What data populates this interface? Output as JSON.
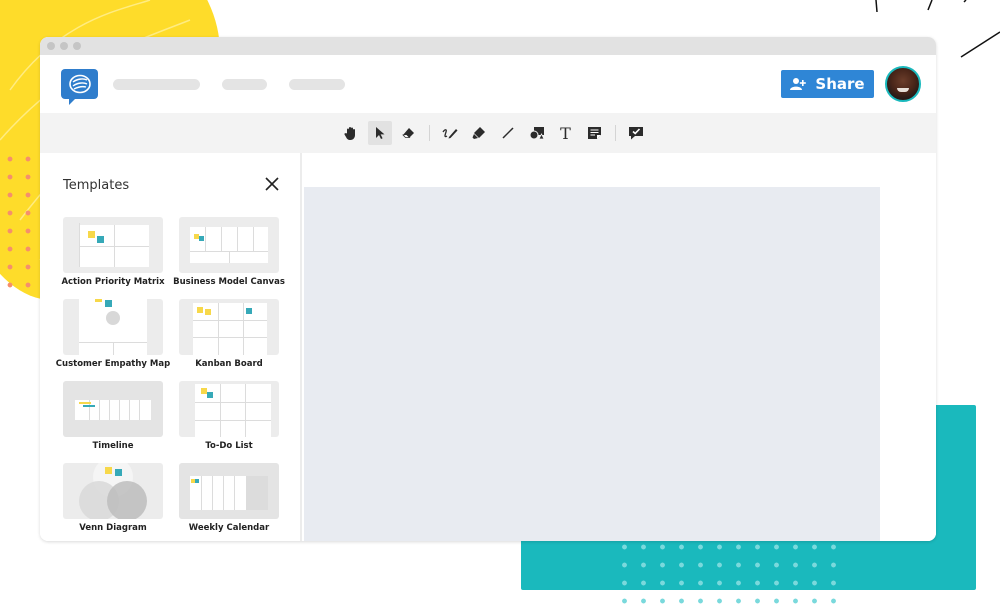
{
  "app": {
    "window_controls": [
      "close",
      "minimize",
      "maximize"
    ],
    "logo_icon": "chat-bubble-logo-icon",
    "nav_placeholders": 3
  },
  "header": {
    "share_label": "Share",
    "share_icon": "add-user-icon",
    "avatar": "user-avatar"
  },
  "toolbar": {
    "tools": [
      {
        "name": "pan",
        "icon": "hand-icon",
        "active": false
      },
      {
        "name": "select",
        "icon": "cursor-arrow-icon",
        "active": true
      },
      {
        "name": "eraser",
        "icon": "eraser-icon",
        "active": false
      },
      {
        "name": "pen",
        "icon": "pen-icon",
        "active": false
      },
      {
        "name": "highlighter",
        "icon": "highlighter-icon",
        "active": false
      },
      {
        "name": "line",
        "icon": "line-icon",
        "active": false
      },
      {
        "name": "shapes",
        "icon": "shapes-icon",
        "active": false
      },
      {
        "name": "text",
        "icon": "text-icon",
        "active": false
      },
      {
        "name": "sticky-note",
        "icon": "sticky-note-icon",
        "active": false
      },
      {
        "name": "comment",
        "icon": "comment-check-icon",
        "active": false
      }
    ],
    "text_glyph": "T"
  },
  "templates_panel": {
    "title": "Templates",
    "close_icon": "close-icon",
    "items": [
      {
        "label": "Action Priority Matrix"
      },
      {
        "label": "Business Model Canvas"
      },
      {
        "label": "Customer Empathy Map"
      },
      {
        "label": "Kanban Board"
      },
      {
        "label": "Timeline"
      },
      {
        "label": "To-Do List"
      },
      {
        "label": "Venn Diagram"
      },
      {
        "label": "Weekly Calendar"
      }
    ]
  },
  "colors": {
    "brand_blue": "#2f86d6",
    "teal": "#1ab9bd",
    "yellow": "#fedc2a",
    "canvas": "#e8ebf1",
    "sticky_yellow": "#f7d84a",
    "sticky_teal": "#36a9b8"
  }
}
